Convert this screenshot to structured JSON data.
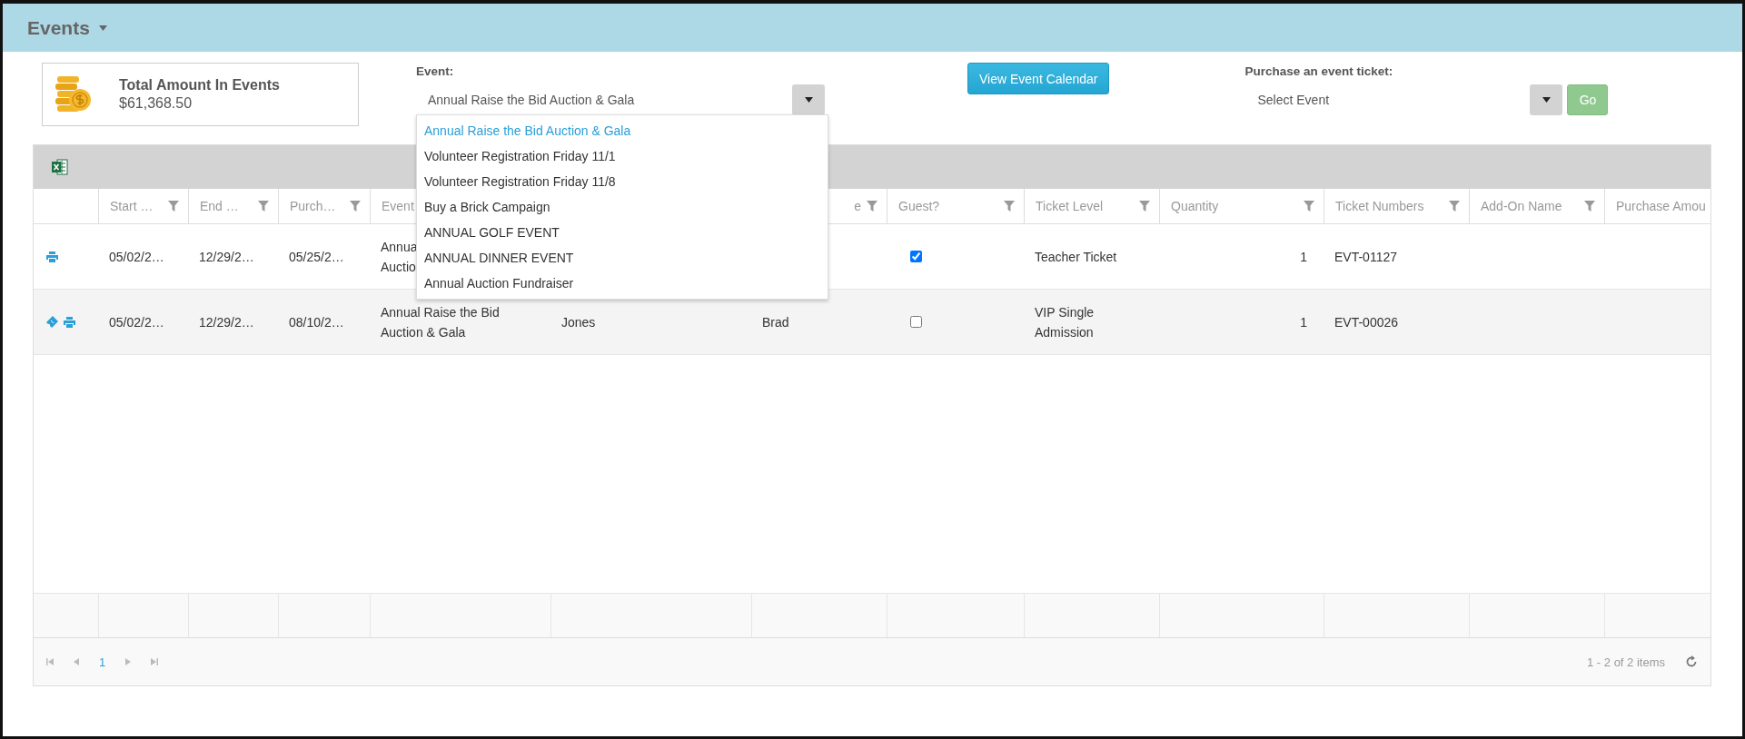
{
  "header": {
    "title": "Events"
  },
  "summary": {
    "label": "Total Amount In Events",
    "amount": "$61,368.50"
  },
  "event_select": {
    "label": "Event:",
    "value": "Annual Raise the Bid Auction & Gala",
    "expanded": true,
    "options": [
      {
        "label": "Annual Raise the Bid Auction & Gala",
        "selected": true
      },
      {
        "label": "Volunteer Registration Friday 11/1",
        "selected": false
      },
      {
        "label": "Volunteer Registration Friday 11/8",
        "selected": false
      },
      {
        "label": "Buy a Brick Campaign",
        "selected": false
      },
      {
        "label": "ANNUAL GOLF EVENT",
        "selected": false
      },
      {
        "label": "ANNUAL DINNER EVENT",
        "selected": false
      },
      {
        "label": "Annual Auction Fundraiser",
        "selected": false
      }
    ]
  },
  "calendar_button": "View Event Calendar",
  "purchase": {
    "label": "Purchase an event ticket:",
    "placeholder": "Select Event",
    "go_button": "Go"
  },
  "table": {
    "columns": [
      {},
      {
        "label": "Start …",
        "filter": true
      },
      {
        "label": "End …",
        "filter": true
      },
      {
        "label": "Purch…",
        "filter": true
      },
      {
        "label": "Event",
        "filter": false
      },
      {},
      {
        "label": "e",
        "filter": true
      },
      {
        "label": "Guest?",
        "filter": true
      },
      {
        "label": "Ticket Level",
        "filter": true
      },
      {
        "label": "Quantity",
        "filter": true
      },
      {
        "label": "Ticket Numbers",
        "filter": true
      },
      {
        "label": "Add-On Name",
        "filter": true
      },
      {
        "label": "Purchase Amou",
        "filter": false
      }
    ],
    "rows": [
      {
        "actions": [
          {
            "kind": "print"
          }
        ],
        "start": "05/02/2…",
        "end": "12/29/2…",
        "purchased": "05/25/2…",
        "event_lines": [
          "Annua",
          "Auctio"
        ],
        "guest": true,
        "ticket_level": "Teacher Ticket",
        "quantity": "1",
        "ticket_numbers": "EVT-01127"
      },
      {
        "actions": [
          {
            "kind": "ticket"
          },
          {
            "kind": "print"
          }
        ],
        "start": "05/02/2…",
        "end": "12/29/2…",
        "purchased": "08/10/2…",
        "event_lines": [
          "Annual Raise the Bid",
          "Auction & Gala"
        ],
        "column_6": "Jones",
        "column_7": "Brad",
        "guest": false,
        "ticket_level": "VIP Single Admission",
        "quantity": "1",
        "ticket_numbers": "EVT-00026"
      }
    ]
  },
  "pager": {
    "pages": [
      {
        "label": "1",
        "selected": true
      }
    ],
    "info": "1 - 2 of 2 items"
  }
}
